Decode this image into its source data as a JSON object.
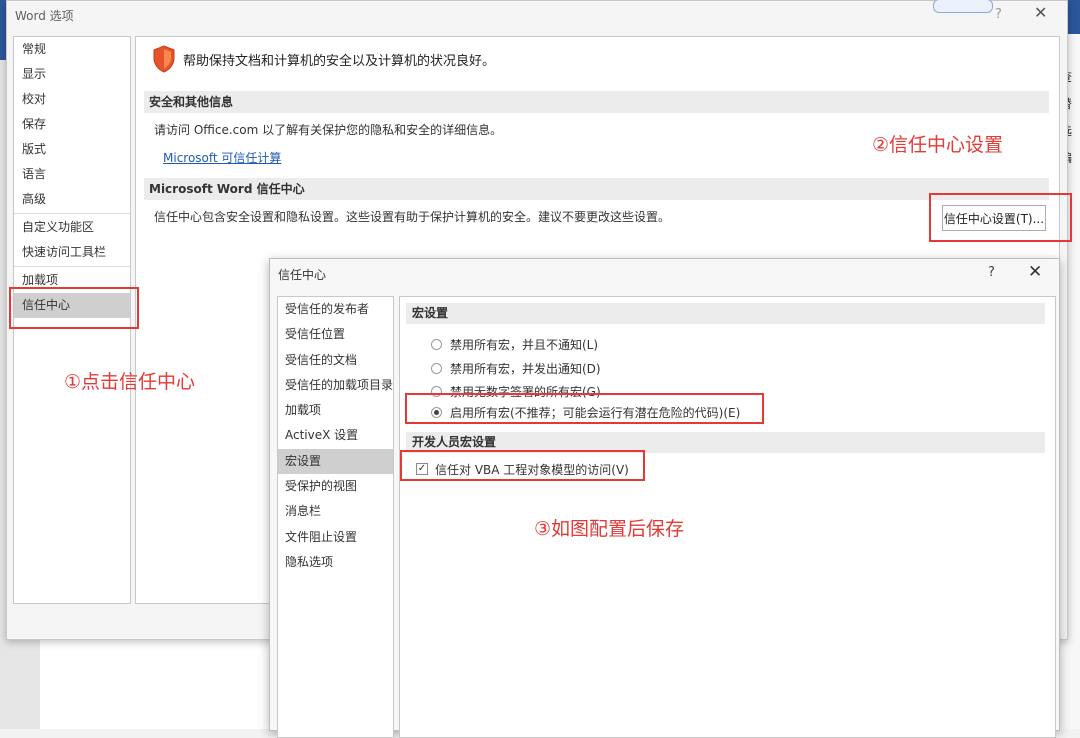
{
  "background": {
    "right_labels": [
      "查",
      "替",
      "选",
      "编"
    ]
  },
  "options_dialog": {
    "title": "Word 选项",
    "help": "?",
    "close": "✕",
    "nav_items": [
      "常规",
      "显示",
      "校对",
      "保存",
      "版式",
      "语言",
      "高级",
      "自定义功能区",
      "快速访问工具栏",
      "加载项",
      "信任中心"
    ],
    "selected_nav": "信任中心",
    "intro": "帮助保持文档和计算机的安全以及计算机的状况良好。",
    "section1_title": "安全和其他信息",
    "office_text": "请访问 Office.com 以了解有关保护您的隐私和安全的详细信息。",
    "link": "Microsoft 可信任计算",
    "section2_title": "Microsoft Word 信任中心",
    "trust_text": "信任中心包含安全设置和隐私设置。这些设置有助于保护计算机的安全。建议不要更改这些设置。",
    "trust_button": "信任中心设置(T)..."
  },
  "trust_center": {
    "title": "信任中心",
    "help": "?",
    "close": "✕",
    "nav_items": [
      "受信任的发布者",
      "受信任位置",
      "受信任的文档",
      "受信任的加载项目录",
      "加载项",
      "ActiveX 设置",
      "宏设置",
      "受保护的视图",
      "消息栏",
      "文件阻止设置",
      "隐私选项"
    ],
    "selected_nav": "宏设置",
    "macro_section": "宏设置",
    "macro_options": [
      {
        "label": "禁用所有宏，并且不通知(L)",
        "selected": false
      },
      {
        "label": "禁用所有宏，并发出通知(D)",
        "selected": false
      },
      {
        "label": "禁用无数字签署的所有宏(G)",
        "selected": false
      },
      {
        "label": "启用所有宏(不推荐；可能会运行有潜在危险的代码)(E)",
        "selected": true
      }
    ],
    "dev_section": "开发人员宏设置",
    "vba_checkbox": {
      "label": "信任对 VBA 工程对象模型的访问(V)",
      "checked": true
    }
  },
  "annotations": {
    "step1": "①点击信任中心",
    "step2": "②信任中心设置",
    "step3": "③如图配置后保存",
    "color": "#e53935"
  }
}
